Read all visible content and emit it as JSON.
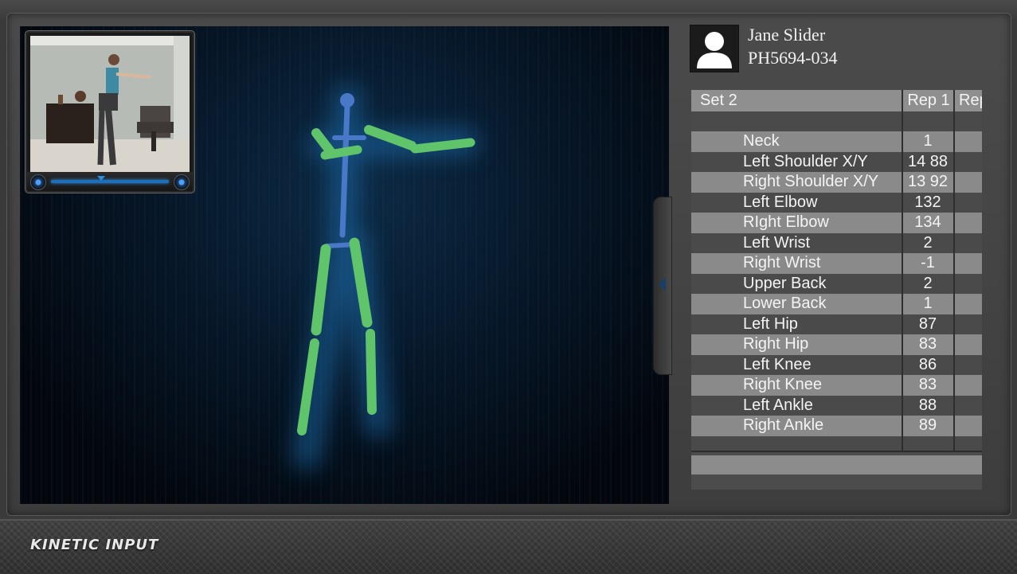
{
  "app": {
    "brand": "KINETIC INPUT"
  },
  "patient": {
    "name": "Jane Slider",
    "id": "PH5694-034",
    "avatar_icon": "user-avatar-icon"
  },
  "table": {
    "set_label": "Set 2",
    "columns": [
      "Rep 1",
      "Rep"
    ],
    "rows": [
      {
        "joint": "Neck",
        "rep1": "1"
      },
      {
        "joint": "Left Shoulder X/Y",
        "rep1": "14 88"
      },
      {
        "joint": "Right Shoulder X/Y",
        "rep1": "13 92"
      },
      {
        "joint": "Left Elbow",
        "rep1": "132"
      },
      {
        "joint": "RIght Elbow",
        "rep1": "134"
      },
      {
        "joint": "Left Wrist",
        "rep1": "2"
      },
      {
        "joint": "Right Wrist",
        "rep1": "-1"
      },
      {
        "joint": "Upper Back",
        "rep1": "2"
      },
      {
        "joint": "Lower Back",
        "rep1": "1"
      },
      {
        "joint": "Left Hip",
        "rep1": "87"
      },
      {
        "joint": "Right Hip",
        "rep1": "83"
      },
      {
        "joint": "Left Knee",
        "rep1": "86"
      },
      {
        "joint": "Right Knee",
        "rep1": "83"
      },
      {
        "joint": "Left Ankle",
        "rep1": "88"
      },
      {
        "joint": "Right Ankle",
        "rep1": "89"
      }
    ]
  },
  "colors": {
    "skeleton_limb": "#5fc46a",
    "skeleton_spine": "#4a78c8",
    "accent_blue": "#2f8de0"
  }
}
